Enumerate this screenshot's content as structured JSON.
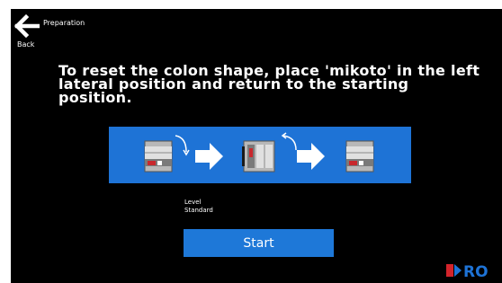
{
  "header": {
    "back_label": "Back",
    "title": "Preparation"
  },
  "main": {
    "instruction": "To reset the colon shape, place 'mikoto' in the left lateral position and return to the starting position.",
    "level_label": "Level",
    "level_value": "Standard",
    "start_label": "Start"
  },
  "logo": {
    "text": "RO"
  },
  "colors": {
    "background": "#000000",
    "accent_blue": "#1e73d6",
    "button_blue": "#1e78d8",
    "logo_red": "#d3242b",
    "logo_blue": "#1e73d6"
  },
  "icons": [
    "arrow-left-icon",
    "arrow-right-icon",
    "rotate-arrow-icon"
  ]
}
